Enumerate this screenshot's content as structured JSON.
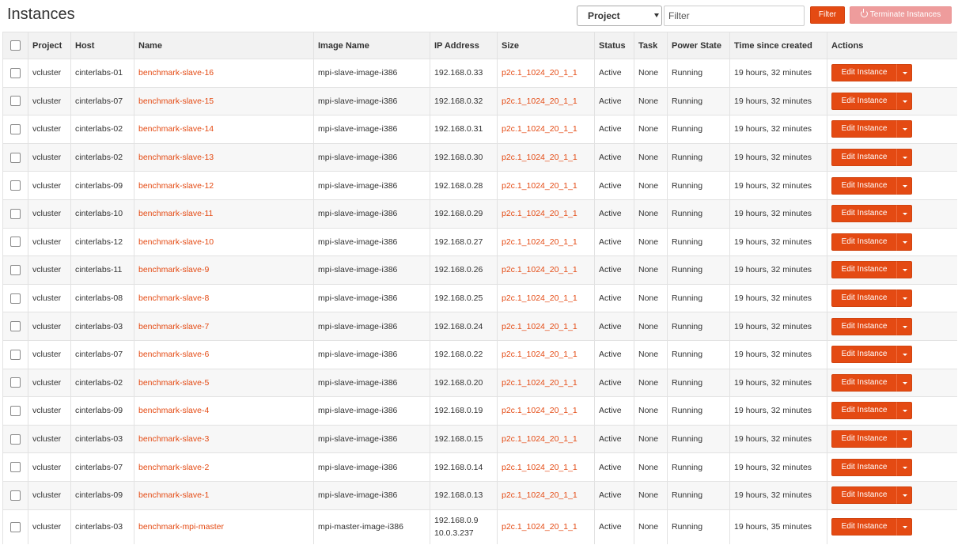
{
  "page": {
    "title": "Instances"
  },
  "toolbar": {
    "select_value": "Project",
    "filter_placeholder": "Filter",
    "filter_button": "Filter",
    "terminate_button": "Terminate Instances"
  },
  "colors": {
    "accent": "#e44a13",
    "terminate_disabled": "#ee9c9c"
  },
  "table": {
    "headers": [
      "Project",
      "Host",
      "Name",
      "Image Name",
      "IP Address",
      "Size",
      "Status",
      "Task",
      "Power State",
      "Time since created",
      "Actions"
    ],
    "action_label": "Edit Instance",
    "rows": [
      {
        "project": "vcluster",
        "host": "cinterlabs-01",
        "name": "benchmark-slave-16",
        "image": "mpi-slave-image-i386",
        "ip": "192.168.0.33",
        "ip2": "",
        "size": "p2c.1_1024_20_1_1",
        "status": "Active",
        "task": "None",
        "power": "Running",
        "time": "19 hours, 32 minutes"
      },
      {
        "project": "vcluster",
        "host": "cinterlabs-07",
        "name": "benchmark-slave-15",
        "image": "mpi-slave-image-i386",
        "ip": "192.168.0.32",
        "ip2": "",
        "size": "p2c.1_1024_20_1_1",
        "status": "Active",
        "task": "None",
        "power": "Running",
        "time": "19 hours, 32 minutes"
      },
      {
        "project": "vcluster",
        "host": "cinterlabs-02",
        "name": "benchmark-slave-14",
        "image": "mpi-slave-image-i386",
        "ip": "192.168.0.31",
        "ip2": "",
        "size": "p2c.1_1024_20_1_1",
        "status": "Active",
        "task": "None",
        "power": "Running",
        "time": "19 hours, 32 minutes"
      },
      {
        "project": "vcluster",
        "host": "cinterlabs-02",
        "name": "benchmark-slave-13",
        "image": "mpi-slave-image-i386",
        "ip": "192.168.0.30",
        "ip2": "",
        "size": "p2c.1_1024_20_1_1",
        "status": "Active",
        "task": "None",
        "power": "Running",
        "time": "19 hours, 32 minutes"
      },
      {
        "project": "vcluster",
        "host": "cinterlabs-09",
        "name": "benchmark-slave-12",
        "image": "mpi-slave-image-i386",
        "ip": "192.168.0.28",
        "ip2": "",
        "size": "p2c.1_1024_20_1_1",
        "status": "Active",
        "task": "None",
        "power": "Running",
        "time": "19 hours, 32 minutes"
      },
      {
        "project": "vcluster",
        "host": "cinterlabs-10",
        "name": "benchmark-slave-11",
        "image": "mpi-slave-image-i386",
        "ip": "192.168.0.29",
        "ip2": "",
        "size": "p2c.1_1024_20_1_1",
        "status": "Active",
        "task": "None",
        "power": "Running",
        "time": "19 hours, 32 minutes"
      },
      {
        "project": "vcluster",
        "host": "cinterlabs-12",
        "name": "benchmark-slave-10",
        "image": "mpi-slave-image-i386",
        "ip": "192.168.0.27",
        "ip2": "",
        "size": "p2c.1_1024_20_1_1",
        "status": "Active",
        "task": "None",
        "power": "Running",
        "time": "19 hours, 32 minutes"
      },
      {
        "project": "vcluster",
        "host": "cinterlabs-11",
        "name": "benchmark-slave-9",
        "image": "mpi-slave-image-i386",
        "ip": "192.168.0.26",
        "ip2": "",
        "size": "p2c.1_1024_20_1_1",
        "status": "Active",
        "task": "None",
        "power": "Running",
        "time": "19 hours, 32 minutes"
      },
      {
        "project": "vcluster",
        "host": "cinterlabs-08",
        "name": "benchmark-slave-8",
        "image": "mpi-slave-image-i386",
        "ip": "192.168.0.25",
        "ip2": "",
        "size": "p2c.1_1024_20_1_1",
        "status": "Active",
        "task": "None",
        "power": "Running",
        "time": "19 hours, 32 minutes"
      },
      {
        "project": "vcluster",
        "host": "cinterlabs-03",
        "name": "benchmark-slave-7",
        "image": "mpi-slave-image-i386",
        "ip": "192.168.0.24",
        "ip2": "",
        "size": "p2c.1_1024_20_1_1",
        "status": "Active",
        "task": "None",
        "power": "Running",
        "time": "19 hours, 32 minutes"
      },
      {
        "project": "vcluster",
        "host": "cinterlabs-07",
        "name": "benchmark-slave-6",
        "image": "mpi-slave-image-i386",
        "ip": "192.168.0.22",
        "ip2": "",
        "size": "p2c.1_1024_20_1_1",
        "status": "Active",
        "task": "None",
        "power": "Running",
        "time": "19 hours, 32 minutes"
      },
      {
        "project": "vcluster",
        "host": "cinterlabs-02",
        "name": "benchmark-slave-5",
        "image": "mpi-slave-image-i386",
        "ip": "192.168.0.20",
        "ip2": "",
        "size": "p2c.1_1024_20_1_1",
        "status": "Active",
        "task": "None",
        "power": "Running",
        "time": "19 hours, 32 minutes"
      },
      {
        "project": "vcluster",
        "host": "cinterlabs-09",
        "name": "benchmark-slave-4",
        "image": "mpi-slave-image-i386",
        "ip": "192.168.0.19",
        "ip2": "",
        "size": "p2c.1_1024_20_1_1",
        "status": "Active",
        "task": "None",
        "power": "Running",
        "time": "19 hours, 32 minutes"
      },
      {
        "project": "vcluster",
        "host": "cinterlabs-03",
        "name": "benchmark-slave-3",
        "image": "mpi-slave-image-i386",
        "ip": "192.168.0.15",
        "ip2": "",
        "size": "p2c.1_1024_20_1_1",
        "status": "Active",
        "task": "None",
        "power": "Running",
        "time": "19 hours, 32 minutes"
      },
      {
        "project": "vcluster",
        "host": "cinterlabs-07",
        "name": "benchmark-slave-2",
        "image": "mpi-slave-image-i386",
        "ip": "192.168.0.14",
        "ip2": "",
        "size": "p2c.1_1024_20_1_1",
        "status": "Active",
        "task": "None",
        "power": "Running",
        "time": "19 hours, 32 minutes"
      },
      {
        "project": "vcluster",
        "host": "cinterlabs-09",
        "name": "benchmark-slave-1",
        "image": "mpi-slave-image-i386",
        "ip": "192.168.0.13",
        "ip2": "",
        "size": "p2c.1_1024_20_1_1",
        "status": "Active",
        "task": "None",
        "power": "Running",
        "time": "19 hours, 32 minutes"
      },
      {
        "project": "vcluster",
        "host": "cinterlabs-03",
        "name": "benchmark-mpi-master",
        "image": "mpi-master-image-i386",
        "ip": "192.168.0.9",
        "ip2": "10.0.3.237",
        "size": "p2c.1_1024_20_1_1",
        "status": "Active",
        "task": "None",
        "power": "Running",
        "time": "19 hours, 35 minutes"
      }
    ]
  }
}
